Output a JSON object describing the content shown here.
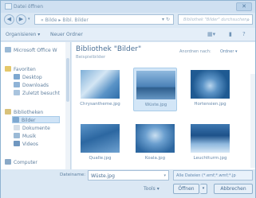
{
  "window": {
    "title": "Datei öffnen",
    "close_glyph": "✕"
  },
  "nav": {
    "back_glyph": "◀",
    "forward_glyph": "▶",
    "address_path": "« Bilde  ▸  Bibl. Bilder",
    "search_placeholder": "Bibliothek \"Bilder\" durchsuchen"
  },
  "toolbar": {
    "organize": "Organisieren ▾",
    "new_folder": "Neuer Ordner"
  },
  "sidebar": {
    "items": [
      {
        "label": "Microsoft Office W",
        "kind": "app"
      },
      {
        "label": "Favoriten",
        "kind": "group"
      },
      {
        "label": "Desktop",
        "kind": "sub"
      },
      {
        "label": "Downloads",
        "kind": "sub"
      },
      {
        "label": "Zuletzt besucht",
        "kind": "sub"
      },
      {
        "label": "Bibliotheken",
        "kind": "group"
      },
      {
        "label": "Bilder",
        "kind": "sub-selected"
      },
      {
        "label": "Dokumente",
        "kind": "sub"
      },
      {
        "label": "Musik",
        "kind": "sub"
      },
      {
        "label": "Videos",
        "kind": "sub"
      },
      {
        "label": "Computer",
        "kind": "group"
      }
    ]
  },
  "content": {
    "library_title": "Bibliothek \"Bilder\"",
    "library_subtitle": "Beispielbilder",
    "arrange_label": "Anordnen nach:",
    "arrange_value": "Ordner ▾",
    "files": [
      {
        "name": "Chrysantheme.jpg",
        "selected": false
      },
      {
        "name": "Wüste.jpg",
        "selected": true
      },
      {
        "name": "Hortensien.jpg",
        "selected": false
      },
      {
        "name": "Qualle.jpg",
        "selected": false
      },
      {
        "name": "Koala.jpg",
        "selected": false
      },
      {
        "name": "Leuchtturm.jpg",
        "selected": false
      }
    ]
  },
  "footer": {
    "filename_label": "Dateiname:",
    "filename_value": "Wüste.jpg",
    "filter_value": "Alle Dateien (*.emf;*.wmf;*.jp",
    "tools_label": "Tools ▾",
    "open_label": "Öffnen",
    "cancel_label": "Abbrechen"
  }
}
